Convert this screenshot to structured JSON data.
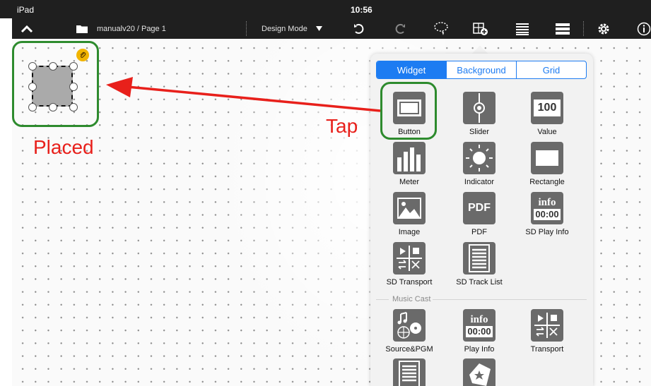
{
  "status_bar": {
    "device": "iPad",
    "time": "10:56"
  },
  "toolbar": {
    "path": "manualv20 / Page 1",
    "mode": "Design Mode"
  },
  "annotations": {
    "placed": "Placed",
    "tap": "Tap"
  },
  "popup": {
    "tabs": [
      "Widget",
      "Background",
      "Grid"
    ],
    "active_tab": "Widget",
    "widgets": [
      {
        "label": "Button",
        "icon": "button-icon"
      },
      {
        "label": "Slider",
        "icon": "slider-icon"
      },
      {
        "label": "Value",
        "icon": "value-icon",
        "icon_text": "100"
      },
      {
        "label": "Meter",
        "icon": "meter-icon"
      },
      {
        "label": "Indicator",
        "icon": "indicator-icon"
      },
      {
        "label": "Rectangle",
        "icon": "rectangle-icon"
      },
      {
        "label": "Image",
        "icon": "image-icon"
      },
      {
        "label": "PDF",
        "icon": "pdf-icon",
        "icon_text": "PDF"
      },
      {
        "label": "SD Play Info",
        "icon": "sd-play-info-icon",
        "icon_text_top": "info",
        "icon_text_bottom": "00:00"
      },
      {
        "label": "SD Transport",
        "icon": "sd-transport-icon"
      },
      {
        "label": "SD Track List",
        "icon": "sd-track-list-icon"
      }
    ],
    "section_title": "Music Cast",
    "music_cast": [
      {
        "label": "Source&PGM",
        "icon": "source-pgm-icon"
      },
      {
        "label": "Play Info",
        "icon": "play-info-icon",
        "icon_text_top": "info",
        "icon_text_bottom": "00:00"
      },
      {
        "label": "Transport",
        "icon": "transport-icon"
      }
    ]
  },
  "colors": {
    "highlight": "#2e8b2e",
    "arrow": "#e8201b",
    "accent": "#1d7cf2"
  }
}
